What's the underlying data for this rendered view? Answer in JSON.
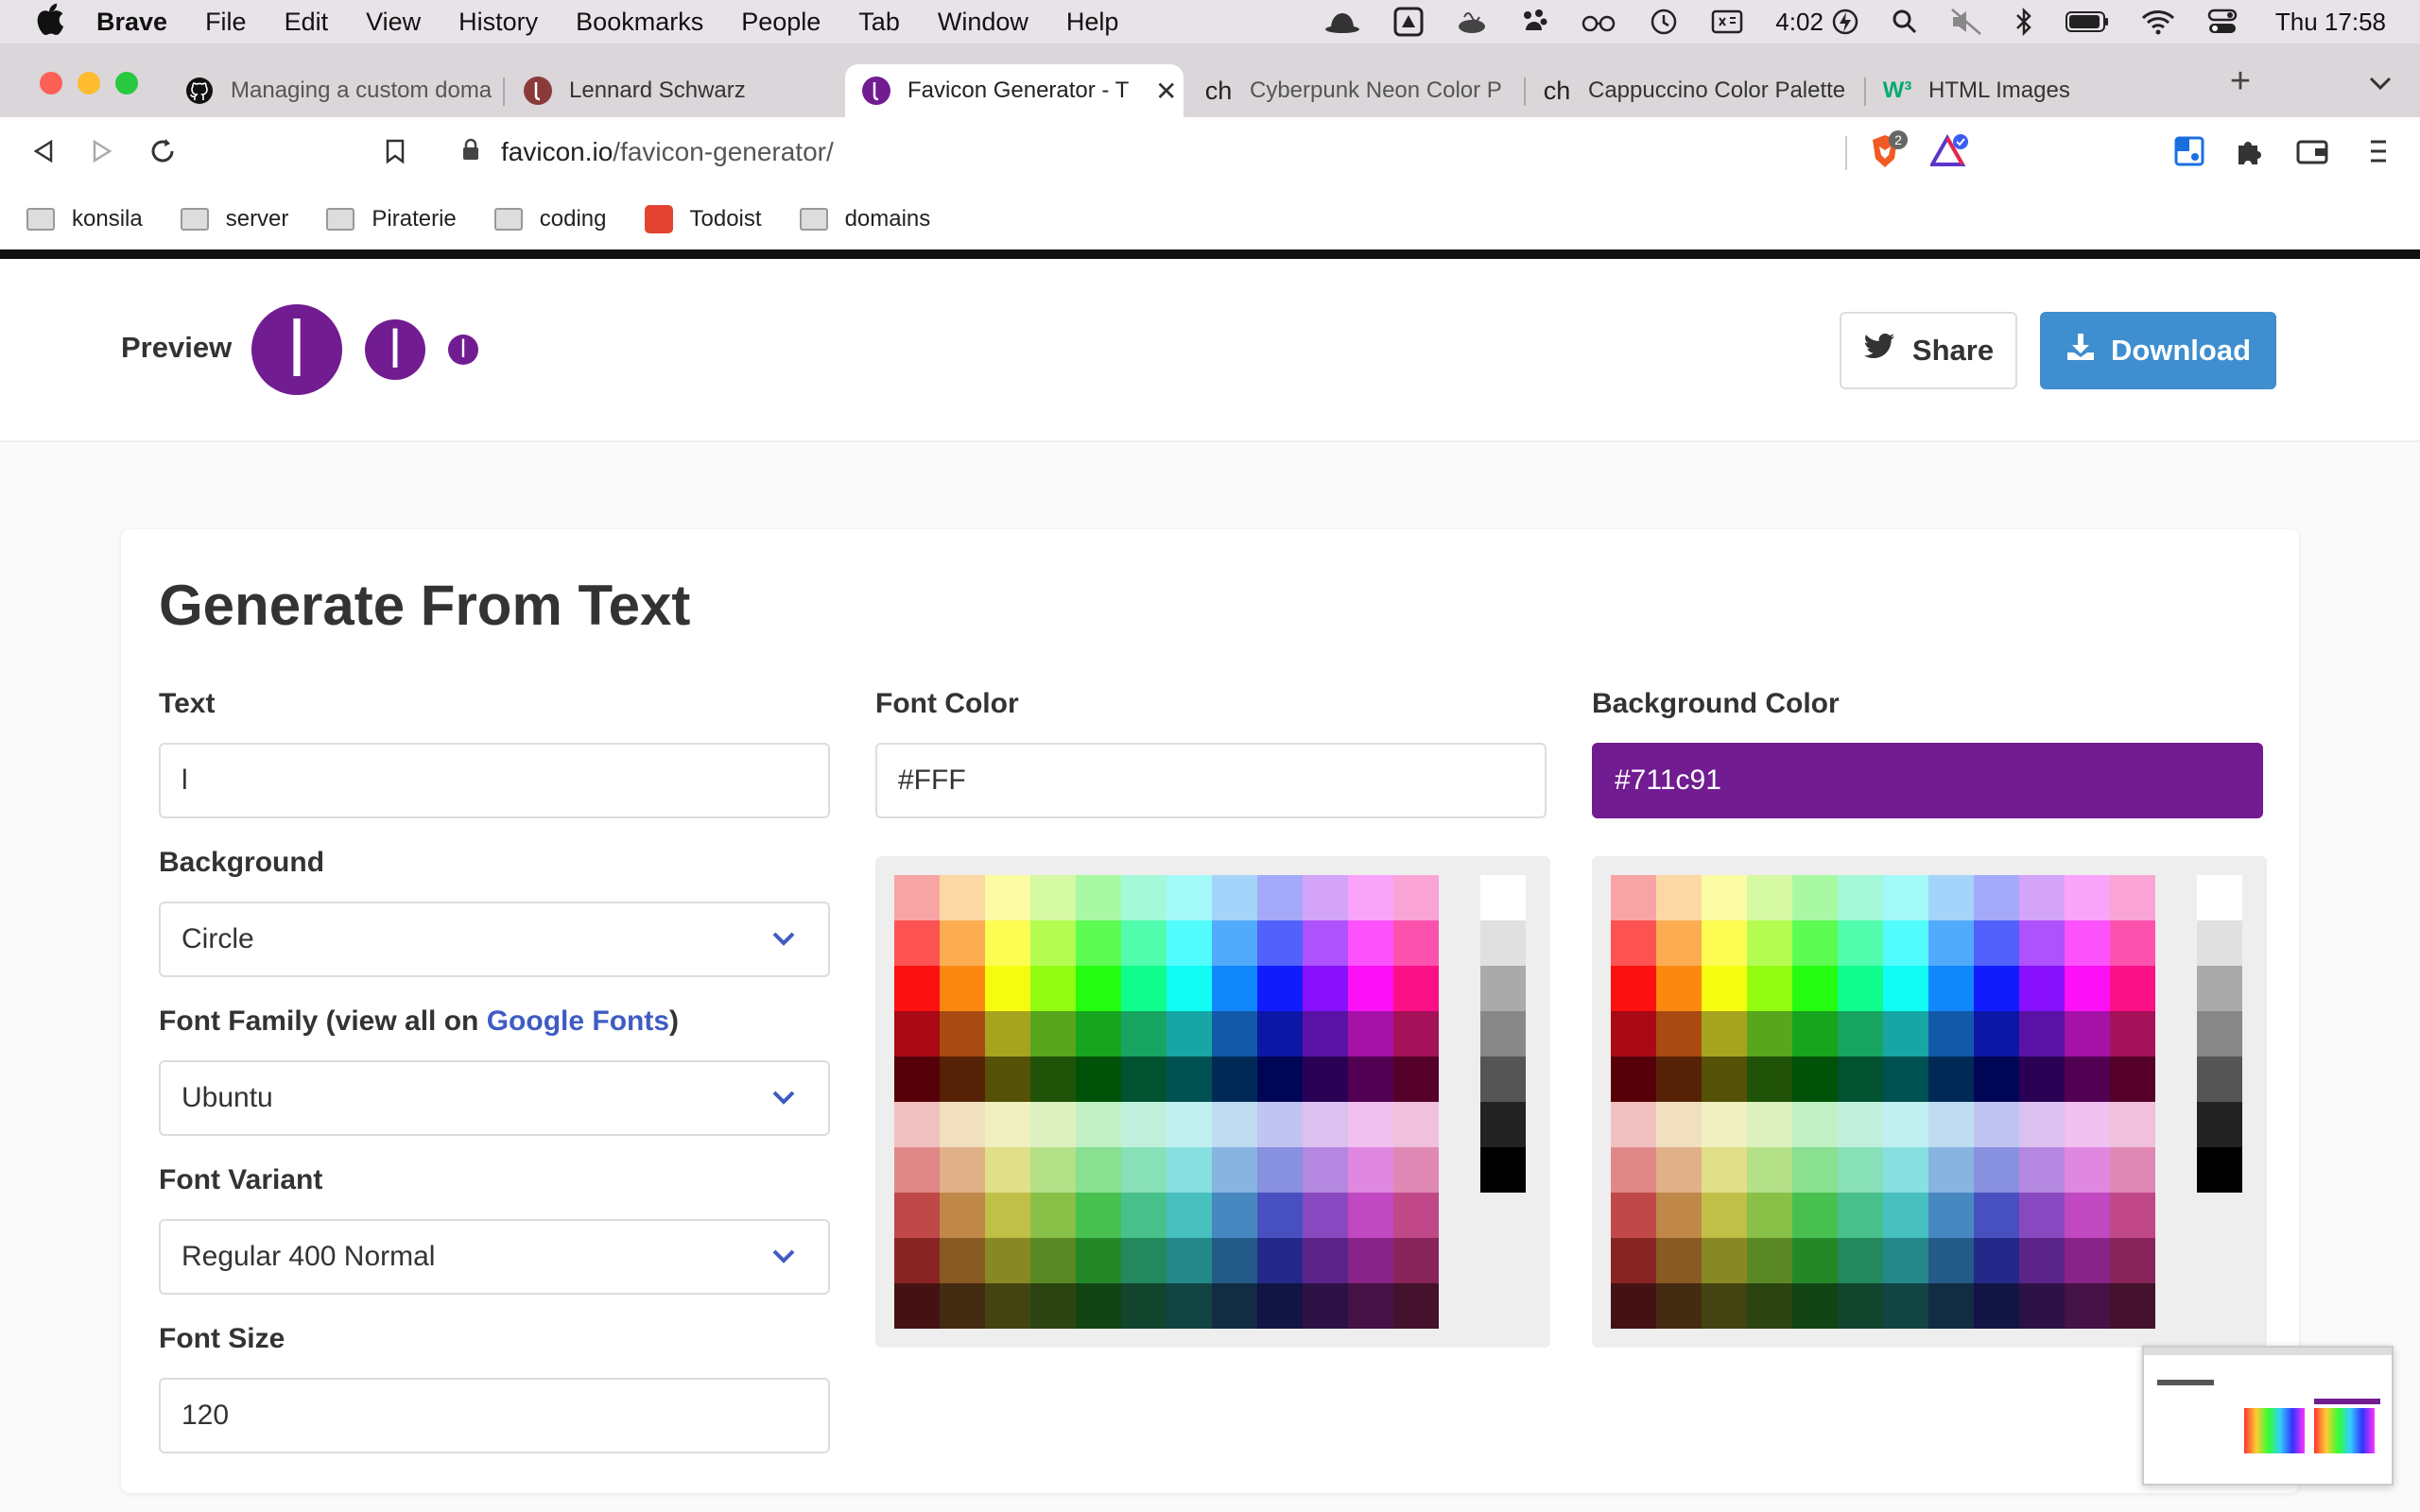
{
  "menubar": {
    "app": "Brave",
    "items": [
      "File",
      "Edit",
      "View",
      "History",
      "Bookmarks",
      "People",
      "Tab",
      "Window",
      "Help"
    ],
    "battery_time": "4:02",
    "clock": "Thu  17:58"
  },
  "tabs": [
    {
      "title": "Managing a custom doma",
      "icon": "github-icon"
    },
    {
      "title": "Lennard Schwarz",
      "icon": "letter-l-favicon"
    },
    {
      "title": "Favicon Generator - T",
      "icon": "letter-l-favicon",
      "active": true
    },
    {
      "title": "Cyberpunk Neon Color P",
      "icon": "ch-logo"
    },
    {
      "title": "Cappuccino Color Palette",
      "icon": "ch-logo"
    },
    {
      "title": "HTML Images",
      "icon": "w3schools-icon"
    }
  ],
  "tab_icon_text": {
    "ch": "ch",
    "w3": "W³"
  },
  "toolbar": {
    "url_host": "favicon.io",
    "url_path": "/favicon-generator/",
    "shields_badge": "2"
  },
  "bookmarks": [
    {
      "label": "konsila",
      "icon": "folder-icon"
    },
    {
      "label": "server",
      "icon": "folder-icon"
    },
    {
      "label": "Piraterie",
      "icon": "folder-icon"
    },
    {
      "label": "coding",
      "icon": "folder-icon"
    },
    {
      "label": "Todoist",
      "icon": "todoist-icon"
    },
    {
      "label": "domains",
      "icon": "folder-icon"
    }
  ],
  "header": {
    "preview_label": "Preview",
    "preview_char": "l",
    "share_label": "Share",
    "download_label": "Download"
  },
  "form": {
    "title": "Generate From Text",
    "text_label": "Text",
    "text_value": "l",
    "background_label": "Background",
    "background_value": "Circle",
    "font_family_label": "Font Family (view all on ",
    "font_family_link": "Google Fonts",
    "font_family_label_end": ")",
    "font_family_value": "Ubuntu",
    "font_variant_label": "Font Variant",
    "font_variant_value": "Regular 400 Normal",
    "font_size_label": "Font Size",
    "font_size_value": "120",
    "font_color_label": "Font Color",
    "font_color_value": "#FFF",
    "bg_color_label": "Background Color",
    "bg_color_value": "#711c91"
  },
  "colors": {
    "brand_purple": "#711c91",
    "download_blue": "#3e8ed0",
    "link_blue": "#3e5cc4"
  },
  "palette": {
    "rows": [
      [
        "#f9a4a4",
        "#fcd9a4",
        "#fcfca4",
        "#d6f9a4",
        "#a9f9a4",
        "#a4f9d9",
        "#a4f9f9",
        "#a4d4f9",
        "#a4a9f9",
        "#d4a4f9",
        "#f9a4f9",
        "#f9a4d4"
      ],
      [
        "#fc5252",
        "#fcad52",
        "#fcfc52",
        "#b5fc52",
        "#5cfc52",
        "#52fcad",
        "#52fcfc",
        "#52aafc",
        "#5261fc",
        "#ad52fc",
        "#fc52fc",
        "#fc52ad"
      ],
      [
        "#fc1010",
        "#fc8810",
        "#f5fc10",
        "#92fc10",
        "#24fc10",
        "#10fc8c",
        "#10fcf5",
        "#1088fc",
        "#101cfc",
        "#8810fc",
        "#fc10f5",
        "#fc1088"
      ],
      [
        "#aa0814",
        "#a84a12",
        "#a5a41e",
        "#58a51e",
        "#18a51e",
        "#18a562",
        "#18a5a5",
        "#125aa8",
        "#0c18a5",
        "#5a12a5",
        "#a512a5",
        "#a5125a"
      ],
      [
        "#550008",
        "#552208",
        "#555208",
        "#205208",
        "#005208",
        "#005230",
        "#005252",
        "#002a55",
        "#000555",
        "#2a0055",
        "#520052",
        "#550028"
      ],
      [
        "#f0c0c0",
        "#f0e0c0",
        "#f0f0c0",
        "#dcf0c0",
        "#c0f0c4",
        "#c0f0dc",
        "#c0f0f0",
        "#c0dcf0",
        "#c0c4f0",
        "#dcc0f0",
        "#f0c0f0",
        "#f0c0dc"
      ],
      [
        "#e08888",
        "#e0b088",
        "#e0e088",
        "#b4e088",
        "#88e090",
        "#88e0b8",
        "#88e0e0",
        "#88b4e0",
        "#8890e0",
        "#b488e0",
        "#e088e0",
        "#e088b4"
      ],
      [
        "#c04848",
        "#c08848",
        "#c0c048",
        "#88c048",
        "#48c050",
        "#48c08c",
        "#48c0c0",
        "#4888c0",
        "#4850c0",
        "#8848c0",
        "#c048c0",
        "#c04888"
      ],
      [
        "#882424",
        "#885a24",
        "#888824",
        "#5a8824",
        "#248828",
        "#24885e",
        "#248888",
        "#245a88",
        "#242888",
        "#5a2488",
        "#882488",
        "#88245a"
      ],
      [
        "#441212",
        "#442c12",
        "#444412",
        "#2c4412",
        "#124414",
        "#12442e",
        "#124444",
        "#122c44",
        "#121444",
        "#2c1244",
        "#441244",
        "#44122c"
      ]
    ],
    "grays": [
      "#ffffff",
      "#e0e0e0",
      "#aaaaaa",
      "#888888",
      "#555555",
      "#222222",
      "#000000"
    ]
  }
}
